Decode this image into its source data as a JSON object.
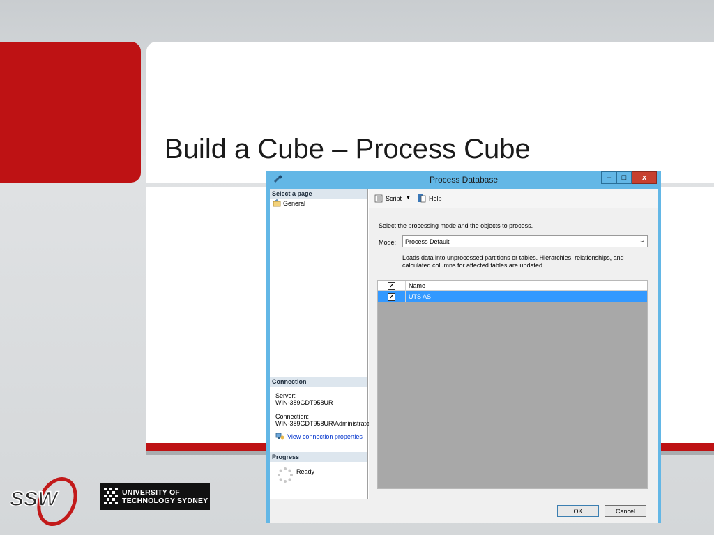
{
  "slide": {
    "title": "Build a Cube – Process Cube"
  },
  "logos": {
    "uts_line1": "UNIVERSITY OF",
    "uts_line2": "TECHNOLOGY SYDNEY"
  },
  "dialog": {
    "title": "Process Database",
    "window_buttons": {
      "minimize": "–",
      "maximize": "□",
      "close": "x"
    },
    "select_page": {
      "header": "Select a page",
      "items": [
        "General"
      ]
    },
    "connection": {
      "header": "Connection",
      "server_label": "Server:",
      "server_value": "WIN-389GDT958UR",
      "connection_label": "Connection:",
      "connection_value": "WIN-389GDT958UR\\Administrato",
      "link": "View connection properties"
    },
    "progress": {
      "header": "Progress",
      "status": "Ready"
    },
    "toolbar": {
      "script": "Script",
      "help": "Help"
    },
    "instruction": "Select the processing mode and the objects to process.",
    "mode": {
      "label": "Mode:",
      "value": "Process Default",
      "description": "Loads data into unprocessed partitions or tables. Hierarchies, relationships, and calculated columns for affected tables are updated."
    },
    "grid": {
      "header": "Name",
      "rows": [
        {
          "name": "UTS AS",
          "checked": true
        }
      ]
    },
    "buttons": {
      "ok": "OK",
      "cancel": "Cancel"
    }
  },
  "colors": {
    "brand_red": "#be1214",
    "titlebar": "#63b7e6",
    "selection": "#3399ff"
  }
}
